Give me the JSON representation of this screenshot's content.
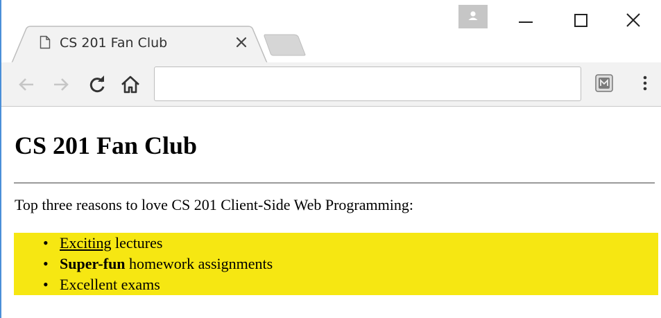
{
  "tab": {
    "title": "CS 201 Fan Club",
    "page_icon": "page-icon",
    "close_icon": "close-icon"
  },
  "window_controls": {
    "profile": "profile-icon",
    "minimize": "minimize-icon",
    "maximize": "maximize-icon",
    "close": "close-icon"
  },
  "toolbar": {
    "back": "back-arrow-icon",
    "forward": "forward-arrow-icon",
    "reload": "reload-icon",
    "home": "home-icon",
    "address_value": "",
    "extension": "extension-icon",
    "menu": "more-vertical-icon"
  },
  "page": {
    "heading": "CS 201 Fan Club",
    "intro": "Top three reasons to love CS 201 Client-Side Web Programming:",
    "reasons": [
      {
        "lead": "Exciting",
        "rest": " lectures"
      },
      {
        "lead": "Super-fun",
        "rest": " homework assignments"
      },
      {
        "lead": "",
        "rest": "Excellent exams"
      }
    ],
    "highlight_color": "#f6e712"
  }
}
